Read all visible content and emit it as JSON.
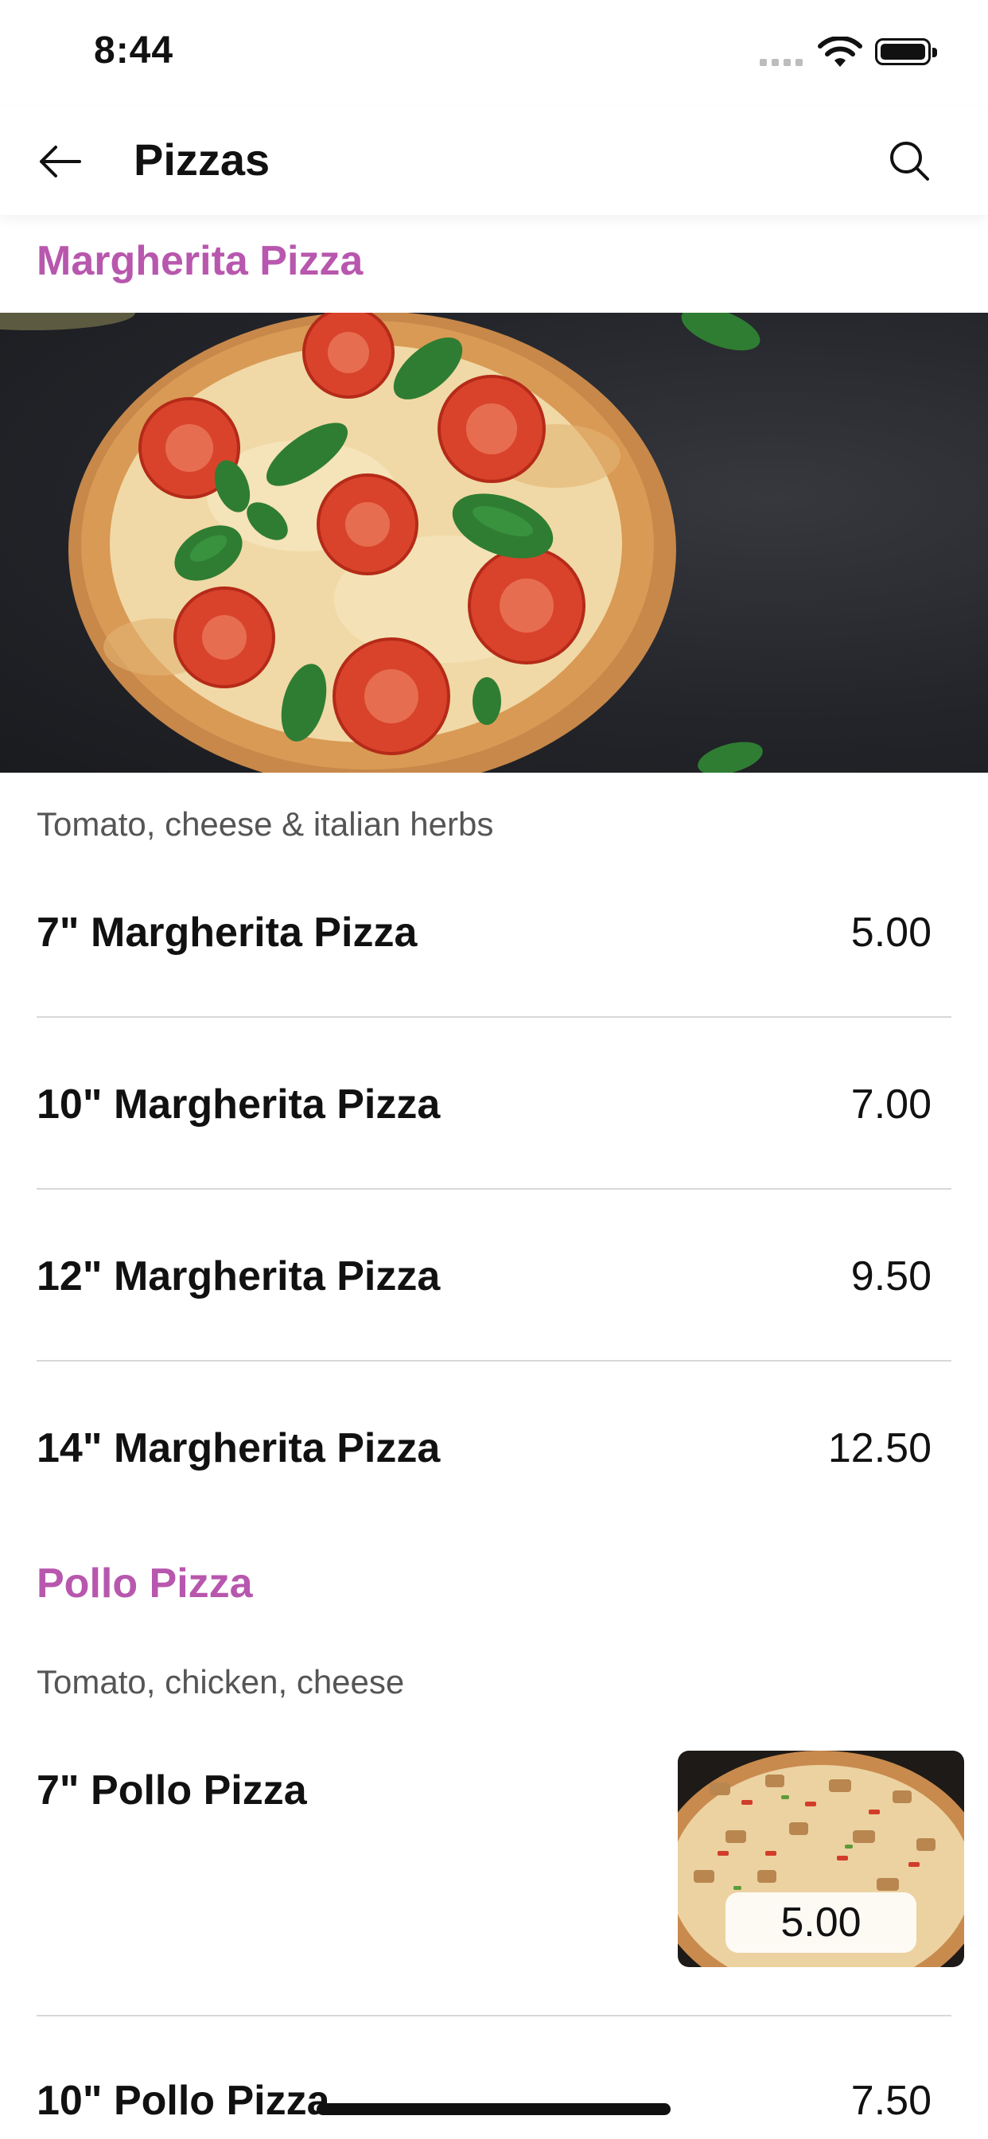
{
  "status_bar": {
    "time": "8:44"
  },
  "nav": {
    "title": "Pizzas"
  },
  "sections": [
    {
      "title": "Margherita Pizza",
      "description": "Tomato, cheese & italian herbs",
      "items": [
        {
          "name": "7\" Margherita Pizza",
          "price": "5.00"
        },
        {
          "name": "10\" Margherita Pizza",
          "price": "7.00"
        },
        {
          "name": "12\" Margherita Pizza",
          "price": "9.50"
        },
        {
          "name": "14\" Margherita Pizza",
          "price": "12.50"
        }
      ]
    },
    {
      "title": "Pollo Pizza",
      "description": "Tomato, chicken, cheese",
      "items": [
        {
          "name": "7\" Pollo Pizza",
          "price": "5.00"
        },
        {
          "name": "10\" Pollo Pizza",
          "price": "7.50"
        }
      ]
    }
  ],
  "icons": {
    "back": "arrow-left-icon",
    "search": "search-icon"
  },
  "colors": {
    "section_title": "#b857ae",
    "divider": "#d8d8d8"
  }
}
